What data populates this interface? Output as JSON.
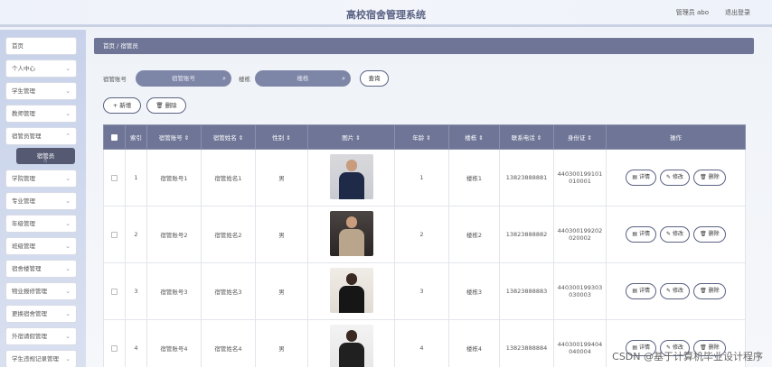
{
  "header": {
    "title": "高校宿舍管理系统",
    "user_text": "管理员 abo",
    "logout": "退出登录"
  },
  "sidebar": {
    "items": [
      {
        "label": "首页"
      },
      {
        "label": "个人中心"
      },
      {
        "label": "学生管理"
      },
      {
        "label": "教师管理"
      },
      {
        "label": "宿管员管理"
      },
      {
        "label": "学院管理"
      },
      {
        "label": "专业管理"
      },
      {
        "label": "年级管理"
      },
      {
        "label": "班级管理"
      },
      {
        "label": "宿舍楼管理"
      },
      {
        "label": "物业报修管理"
      },
      {
        "label": "更换宿舍管理"
      },
      {
        "label": "外宿请假管理"
      },
      {
        "label": "学生违规记录管理"
      }
    ],
    "active_sub": "宿管员"
  },
  "breadcrumb": "首页 / 宿管员",
  "search": {
    "label1": "宿管账号",
    "placeholder1": "宿管账号",
    "label2": "楼栋",
    "placeholder2": "楼栋",
    "button": "查询"
  },
  "actions": {
    "add": "+ 新增",
    "delete": "删除"
  },
  "table": {
    "columns": [
      "索引",
      "宿管账号",
      "宿管姓名",
      "性别",
      "图片",
      "年龄",
      "楼栋",
      "联系电话",
      "身份证",
      "操作"
    ],
    "rows": [
      {
        "index": "1",
        "account": "宿管账号1",
        "name": "宿管姓名1",
        "gender": "男",
        "age": "1",
        "building": "楼栋1",
        "phone": "13823888881",
        "id_line1": "440300199101",
        "id_line2": "010001"
      },
      {
        "index": "2",
        "account": "宿管账号2",
        "name": "宿管姓名2",
        "gender": "男",
        "age": "2",
        "building": "楼栋2",
        "phone": "13823888882",
        "id_line1": "440300199202",
        "id_line2": "020002"
      },
      {
        "index": "3",
        "account": "宿管账号3",
        "name": "宿管姓名3",
        "gender": "男",
        "age": "3",
        "building": "楼栋3",
        "phone": "13823888883",
        "id_line1": "440300199303",
        "id_line2": "030003"
      },
      {
        "index": "4",
        "account": "宿管账号4",
        "name": "宿管姓名4",
        "gender": "男",
        "age": "4",
        "building": "楼栋4",
        "phone": "13823888884",
        "id_line1": "440300199404",
        "id_line2": "040004"
      }
    ],
    "op_detail": "详情",
    "op_edit": "修改",
    "op_delete": "删除"
  },
  "watermark": "CSDN @基于计算机毕业设计程序"
}
